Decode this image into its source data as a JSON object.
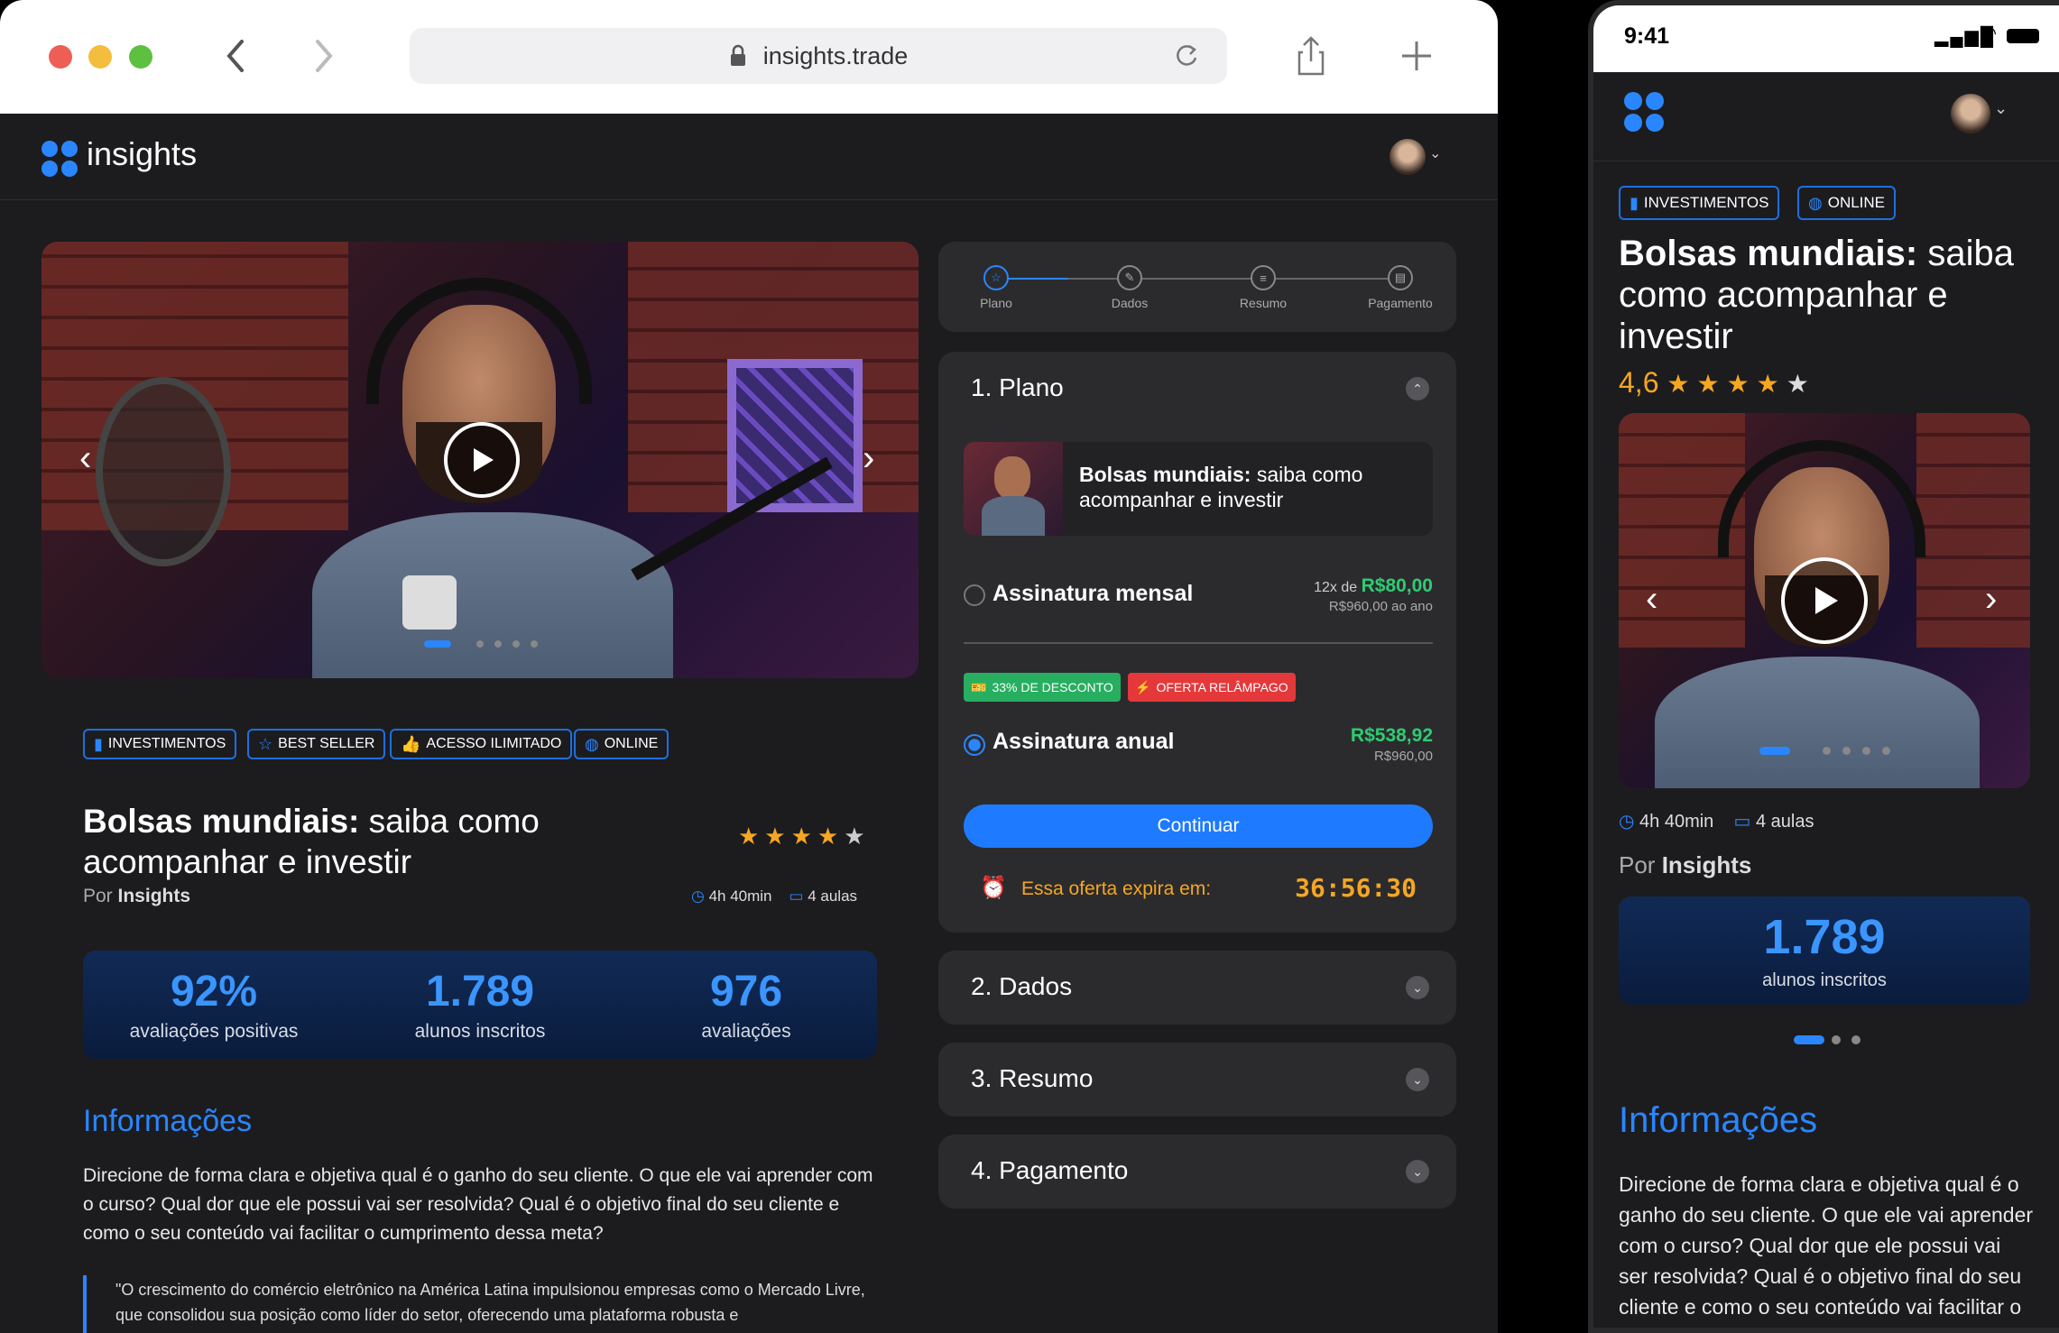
{
  "browser": {
    "url": "insights.trade",
    "colors": {
      "close": "#ed5f55",
      "minimize": "#f5bd3d",
      "maximize": "#5ec041"
    }
  },
  "app": {
    "brand": "insights",
    "accent": "#1e7bff",
    "avatar_icon": "avatar"
  },
  "course": {
    "badges": [
      "INVESTIMENTOS",
      "BEST SELLER",
      "ACESSO ILIMITADO",
      "ONLINE"
    ],
    "title_bold": "Bolsas mundiais:",
    "title_rest": " saiba como acompanhar e investir",
    "by_prefix": "Por ",
    "by_author": "Insights",
    "rating_value": "4,6",
    "rating": 4.6,
    "duration": "4h 40min",
    "lessons": "4 aulas",
    "stats": [
      {
        "value": "92%",
        "label": "avaliações positivas"
      },
      {
        "value": "1.789",
        "label": "alunos inscritos"
      },
      {
        "value": "976",
        "label": "avaliações"
      }
    ],
    "info_title": "Informações",
    "info_text": "Direcione de forma clara e objetiva qual é o ganho do seu cliente. O que ele vai aprender com o curso? Qual dor que ele possui vai ser resolvida? Qual é o objetivo final do seu cliente e como o seu conteúdo vai facilitar o cumprimento dessa meta?",
    "quote": "\"O crescimento do comércio eletrônico na América Latina impulsionou empresas como o Mercado Livre, que consolidou sua posição como líder do setor, oferecendo uma plataforma robusta e"
  },
  "checkout": {
    "steps": [
      "Plano",
      "Dados",
      "Resumo",
      "Pagamento"
    ],
    "sections": [
      "1. Plano",
      "2. Dados",
      "3. Resumo",
      "4. Pagamento"
    ],
    "product_bold": "Bolsas mundiais:",
    "product_rest": " saiba como acompanhar e investir",
    "monthly": {
      "label": "Assinatura mensal",
      "prefix": "12x de ",
      "price": "R$80,00",
      "sub": "R$960,00 ao ano"
    },
    "tags": {
      "discount": "33% DE DESCONTO",
      "flash": "OFERTA RELÂMPAGO"
    },
    "annual": {
      "label": "Assinatura anual",
      "price": "R$538,92",
      "old": "R$960,00"
    },
    "continue": "Continuar",
    "offer_label": "Essa oferta expira em:",
    "countdown": "36:56:30",
    "colors": {
      "green": "#2ecc71",
      "red": "#e5383b",
      "orange": "#f5a623"
    }
  },
  "phone": {
    "time": "9:41",
    "badges": [
      "INVESTIMENTOS",
      "ONLINE"
    ],
    "stat": {
      "value": "1.789",
      "label": "alunos inscritos"
    },
    "info_text": "Direcione de forma clara e objetiva qual é o ganho do seu cliente. O que ele vai aprender com o curso? Qual dor que ele possui vai ser resolvida? Qual é o objetivo final do seu cliente e como o seu conteúdo vai facilitar o cumprimento dessa meta?"
  }
}
